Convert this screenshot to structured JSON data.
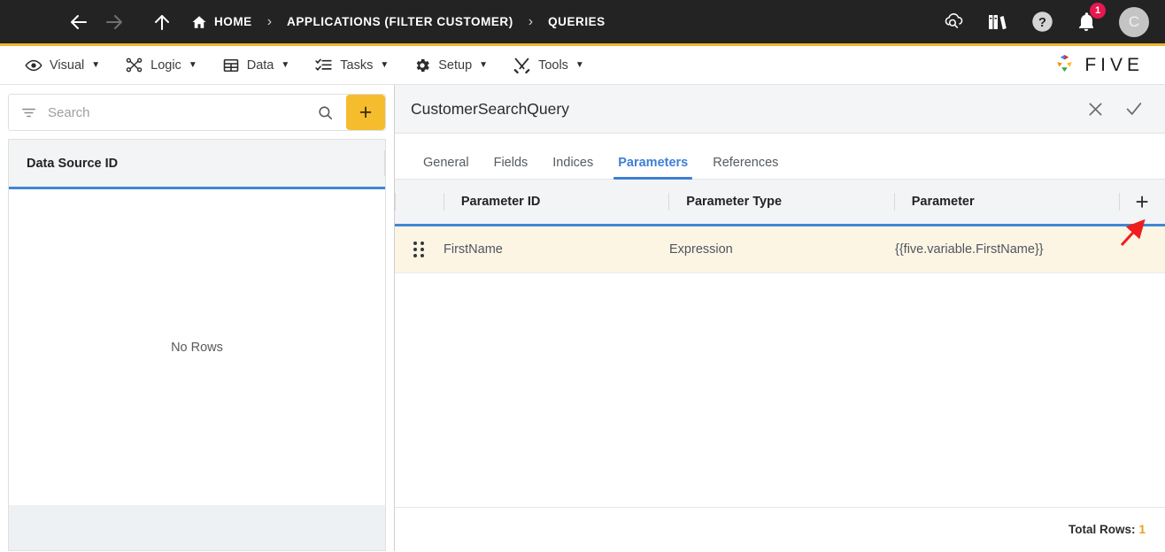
{
  "topbar": {
    "menu_icon": "hamburger-icon",
    "back_icon": "arrow-left-icon",
    "forward_icon": "arrow-right-icon",
    "up_icon": "arrow-up-icon",
    "breadcrumbs": [
      {
        "label": "HOME",
        "icon": "home-icon"
      },
      {
        "label": "APPLICATIONS (FILTER CUSTOMER)",
        "icon": ""
      },
      {
        "label": "QUERIES",
        "icon": ""
      }
    ],
    "separator": "›",
    "right_icons": [
      {
        "name": "cloud-search-icon"
      },
      {
        "name": "library-books-icon"
      },
      {
        "name": "help-icon"
      },
      {
        "name": "notifications-bell-icon",
        "badge": "1"
      }
    ],
    "avatar_letter": "C",
    "accent": "#f3b32b"
  },
  "menubar": {
    "items": [
      {
        "label": "Visual",
        "icon": "eye-icon",
        "caret": "▼"
      },
      {
        "label": "Logic",
        "icon": "logic-flow-icon",
        "caret": "▼"
      },
      {
        "label": "Data",
        "icon": "table-grid-icon",
        "caret": "▼"
      },
      {
        "label": "Tasks",
        "icon": "checklist-icon",
        "caret": "▼"
      },
      {
        "label": "Setup",
        "icon": "gear-icon",
        "caret": "▼"
      },
      {
        "label": "Tools",
        "icon": "tools-icon",
        "caret": "▼"
      }
    ],
    "brand": "FIVE"
  },
  "left_panel": {
    "search": {
      "placeholder": "Search",
      "value": "",
      "filter_icon": "filter-icon",
      "search_icon": "search-icon"
    },
    "add_button_label": "+",
    "grid": {
      "column_header": "Data Source ID",
      "empty_text": "No Rows",
      "rows": []
    }
  },
  "right_panel": {
    "title": "CustomerSearchQuery",
    "close_label": "✕",
    "confirm_label": "✓",
    "tabs": [
      {
        "label": "General",
        "active": false
      },
      {
        "label": "Fields",
        "active": false
      },
      {
        "label": "Indices",
        "active": false
      },
      {
        "label": "Parameters",
        "active": true
      },
      {
        "label": "References",
        "active": false
      }
    ],
    "grid": {
      "columns": [
        "Parameter ID",
        "Parameter Type",
        "Parameter"
      ],
      "add_row_label": "+",
      "rows": [
        {
          "handle": "drag-handle-icon",
          "parameter_id": "FirstName",
          "parameter_type": "Expression",
          "parameter": "{{five.variable.FirstName}}"
        }
      ]
    },
    "footer": {
      "total_rows_label": "Total Rows:",
      "total_rows_value": "1"
    }
  },
  "annotation": {
    "type": "arrow",
    "color": "#ef1d1d",
    "points_to": "add-parameter-row-button"
  }
}
